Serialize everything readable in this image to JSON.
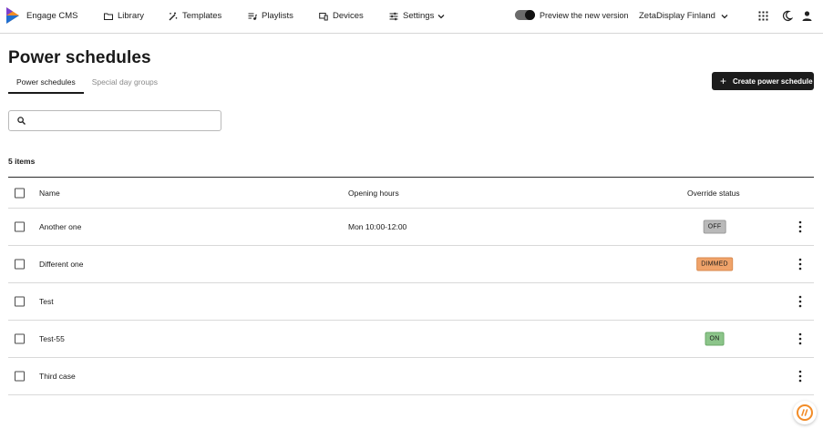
{
  "brand": {
    "name": "Engage CMS",
    "colors": {
      "orange": "#f28c28",
      "blue": "#1f6fd1",
      "purple": "#7a3fd0"
    }
  },
  "nav": {
    "library": "Library",
    "templates": "Templates",
    "playlists": "Playlists",
    "devices": "Devices",
    "settings": "Settings"
  },
  "topright": {
    "preview_label": "Preview the new version",
    "org_name": "ZetaDisplay Finland"
  },
  "page": {
    "title": "Power schedules",
    "tabs": [
      "Power schedules",
      "Special day groups"
    ],
    "create_button": "Create power schedule",
    "search_placeholder": "",
    "item_count": "5 items"
  },
  "table": {
    "columns": {
      "name": "Name",
      "hours": "Opening hours",
      "status": "Override status"
    },
    "rows": [
      {
        "name": "Another one",
        "hours": "Mon 10:00-12:00",
        "status": "OFF"
      },
      {
        "name": "Different one",
        "hours": "",
        "status": "DIMMED"
      },
      {
        "name": "Test",
        "hours": "",
        "status": ""
      },
      {
        "name": "Test-55",
        "hours": "",
        "status": "ON"
      },
      {
        "name": "Third case",
        "hours": "",
        "status": ""
      }
    ]
  },
  "status_colors": {
    "off": "#b9b9b9",
    "dimmed": "#f0a36a",
    "on": "#8cc58a"
  }
}
